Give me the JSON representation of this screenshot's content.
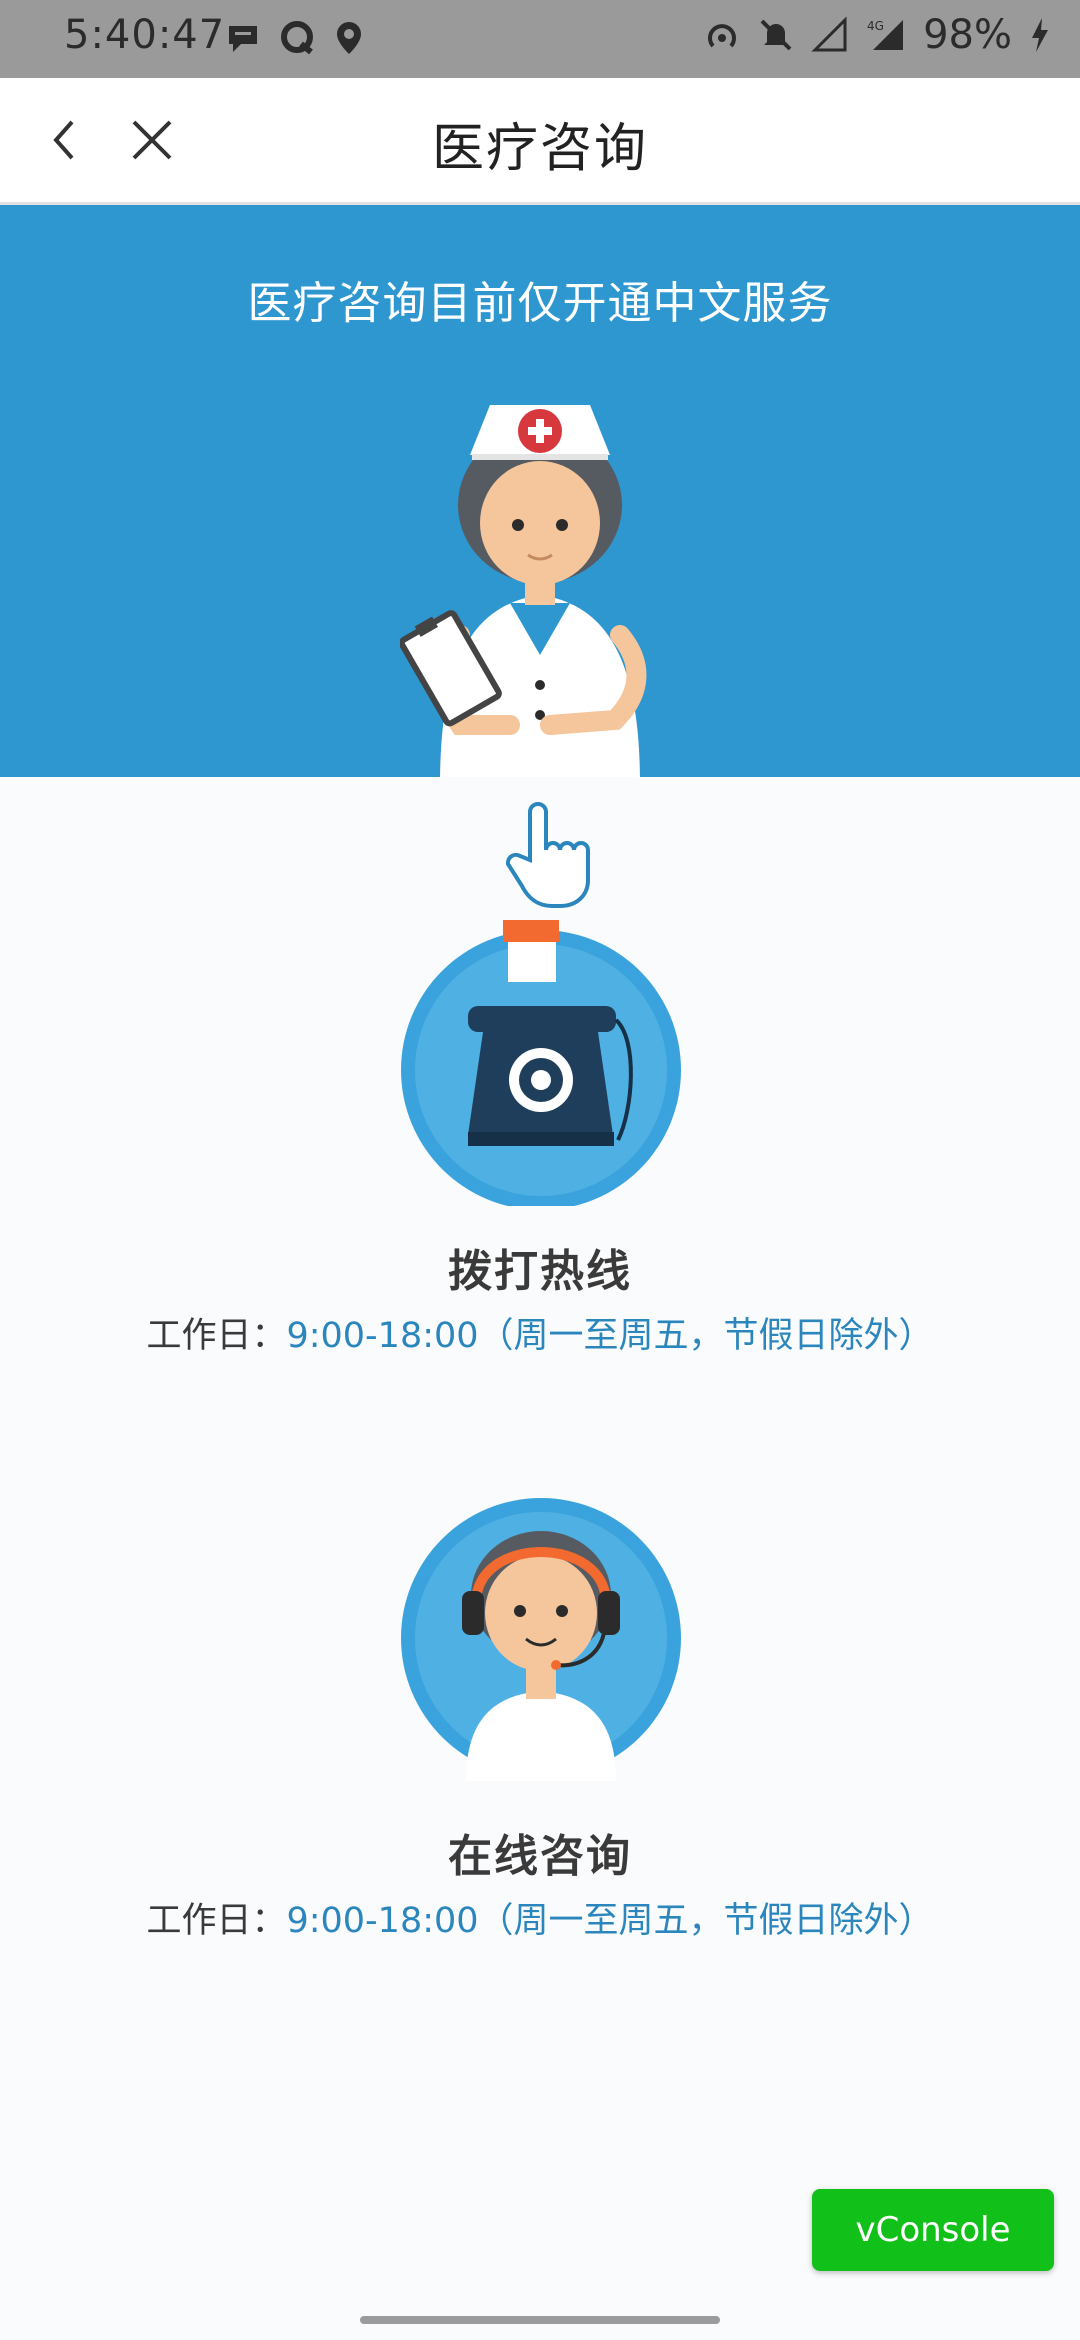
{
  "status_bar": {
    "time": "5:40:47",
    "battery": "98%",
    "left_icons": [
      "message-icon",
      "chat-icon",
      "location-pin-icon"
    ],
    "right_icons": [
      "hotspot-icon",
      "bell-off-icon",
      "signal-icon",
      "4g-signal-icon",
      "charging-icon"
    ]
  },
  "nav": {
    "title": "医疗咨询",
    "back_icon": "chevron-left-icon",
    "close_icon": "close-icon"
  },
  "banner": {
    "notice": "医疗咨询目前仅开通中文服务",
    "background_color": "#2f97d0",
    "illustration": "nurse-illustration"
  },
  "services": [
    {
      "title": "拨打热线",
      "hours_label": "工作日：",
      "hours_value": "9:00-18:00（周一至周五，节假日除外）",
      "icon": "telephone-icon"
    },
    {
      "title": "在线咨询",
      "hours_label": "工作日：",
      "hours_value": "9:00-18:00（周一至周五，节假日除外）",
      "icon": "customer-service-agent-icon"
    }
  ],
  "vconsole": {
    "label": "vConsole",
    "color": "#11c018"
  },
  "colors": {
    "accent": "#2b86bd",
    "icon_circle": "#3aa3dd"
  }
}
